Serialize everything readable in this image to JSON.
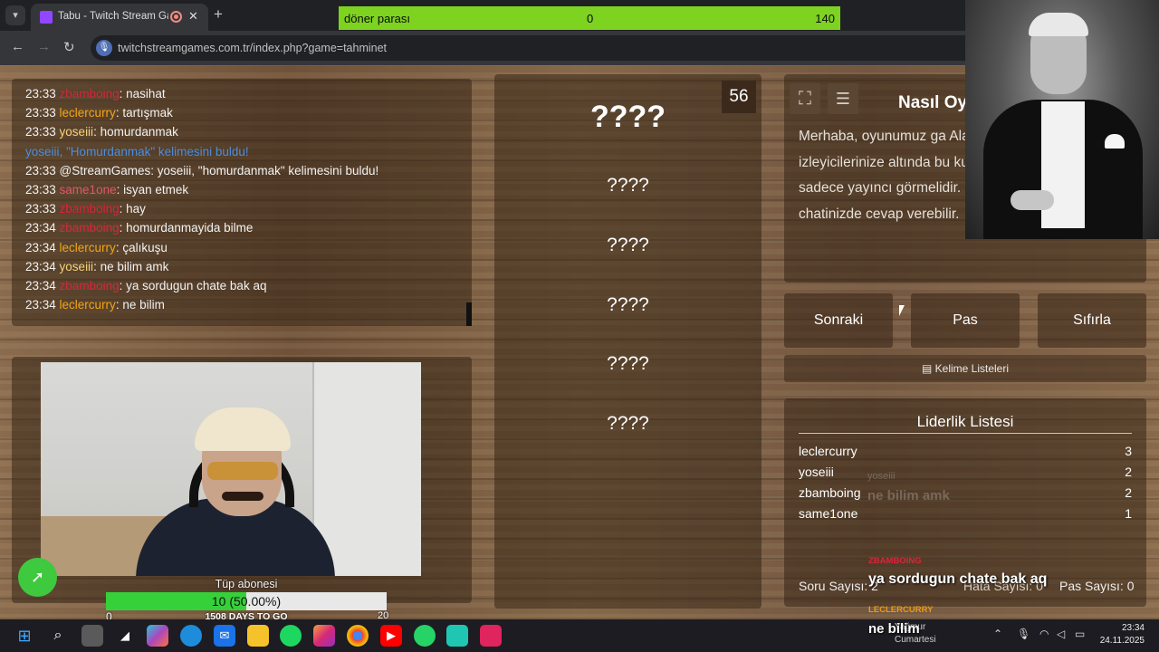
{
  "browser": {
    "tab_title": "Tabu - Twitch Stream Games",
    "url": "twitchstreamgames.com.tr/index.php?game=tahminet",
    "tab_menu_icon": "chevron-down-icon",
    "close_glyph": "✕",
    "new_tab_glyph": "+",
    "back_glyph": "←",
    "forward_glyph": "→",
    "reload_glyph": "↻"
  },
  "goal": {
    "label": "döner parası",
    "current": "0",
    "target": "140",
    "color": "#7ed321"
  },
  "chat": {
    "lines": [
      {
        "time": "23:33",
        "user": "zbamboing",
        "user_color": "#d8253a",
        "text": ": nasihat"
      },
      {
        "time": "23:33",
        "user": "leclercurry",
        "user_color": "#f2a516",
        "text": ": tartışmak"
      },
      {
        "time": "23:33",
        "user": "yoseiii",
        "user_color": "#f7d27a",
        "text": ": homurdanmak"
      },
      {
        "time": "",
        "user": "yoseiii, \"Homurdanmak\" kelimesini buldu!",
        "user_color": "#4a8fe0",
        "text": ""
      },
      {
        "time": "23:33",
        "user": "",
        "user_color": "#ffffff",
        "text": "@StreamGames: yoseiii, \"homurdanmak\" kelimesini buldu!"
      },
      {
        "time": "23:33",
        "user": "same1one",
        "user_color": "#e0566b",
        "text": ": isyan etmek"
      },
      {
        "time": "23:33",
        "user": "zbamboing",
        "user_color": "#d8253a",
        "text": ": hay"
      },
      {
        "time": "23:34",
        "user": "zbamboing",
        "user_color": "#d8253a",
        "text": ": homurdanmayida bilme"
      },
      {
        "time": "23:34",
        "user": "leclercurry",
        "user_color": "#f2a516",
        "text": ": çalıkuşu"
      },
      {
        "time": "23:34",
        "user": "yoseiii",
        "user_color": "#f7d27a",
        "text": ": ne bilim amk"
      },
      {
        "time": "23:34",
        "user": "zbamboing",
        "user_color": "#d8253a",
        "text": ": ya sordugun chate bak aq"
      },
      {
        "time": "23:34",
        "user": "leclercurry",
        "user_color": "#f2a516",
        "text": ": ne bilim"
      }
    ]
  },
  "subs": {
    "title": "Tüp abonesi",
    "bar_text": "10 (50.00%)",
    "fill_fraction": 0.5,
    "min": "0",
    "max": "20",
    "days": "1508 DAYS TO GO"
  },
  "game": {
    "timer": "56",
    "main_word": "????",
    "taboo_words": [
      "????",
      "????",
      "????",
      "????",
      "????"
    ]
  },
  "info": {
    "title": "Nasıl Oy",
    "text": "Merhaba, oyunumuz ga Alanı- olan sol altta ki bö izleyicilerinize altında bu kullanmadan anlatmaya sadece yayıncı görmelidir. İzleyicileriniz yayın chatinizde cevap verebilir.",
    "fullscreen_icon": "fullscreen-icon",
    "notes_icon": "notes-icon"
  },
  "buttons": {
    "next": "Sonraki",
    "pass": "Pas",
    "reset": "Sıfırla",
    "word_lists": "Kelime Listeleri"
  },
  "leaderboard": {
    "title": "Liderlik Listesi",
    "rows": [
      {
        "name": "leclercurry",
        "score": "3"
      },
      {
        "name": "yoseiii",
        "score": "2"
      },
      {
        "name": "zbamboing",
        "score": "2"
      },
      {
        "name": "same1one",
        "score": "1"
      }
    ],
    "questions": "Soru Sayısı: 2",
    "errors": "Hata Sayısı: 0",
    "passes": "Pas Sayısı: 0"
  },
  "overlay_chat": {
    "ghost_user": "yoseiii",
    "ghost_msg": "ne bilim amk",
    "user1": "ZBAMBOING",
    "msg1": "ya sordugun chate bak aq",
    "user2": "LECLERCURRY",
    "msg2": "ne bilim"
  },
  "taskbar": {
    "weather1": "Yağmur",
    "weather2": "Cumartesi",
    "time": "23:34",
    "date": "24.11.2025"
  }
}
